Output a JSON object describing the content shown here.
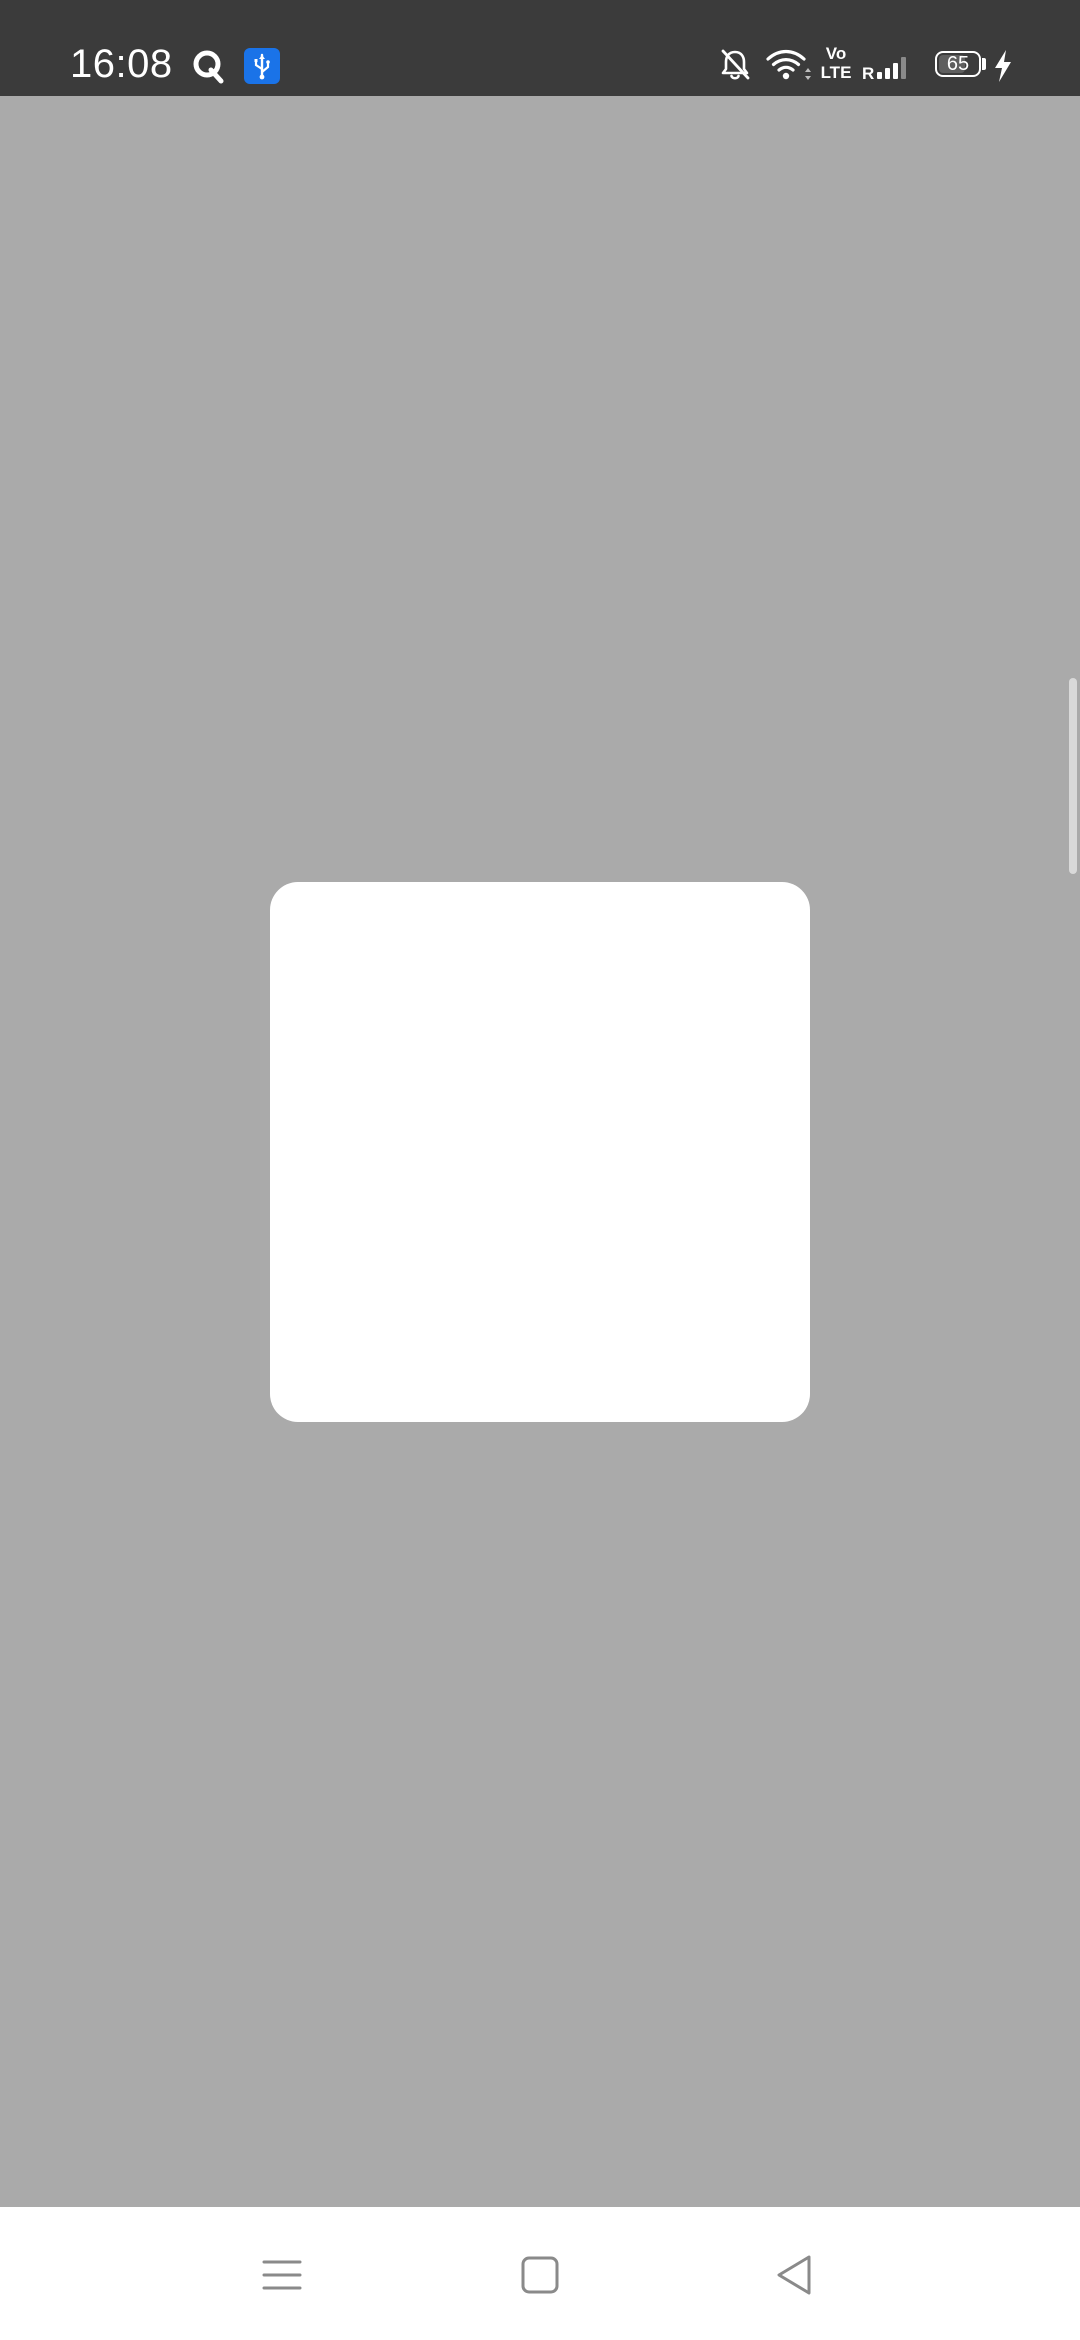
{
  "status_bar": {
    "time": "16:08",
    "volte_top": "Vo",
    "volte_bottom": "LTE",
    "roaming_indicator": "R",
    "battery_level": "65",
    "icons": [
      "q-app-icon",
      "usb-debug-icon",
      "bell-muted-icon",
      "wifi-icon",
      "cell-signal-icon",
      "charging-bolt-icon"
    ]
  },
  "nav_bar": {
    "icons": [
      "menu-icon",
      "home-icon",
      "back-icon"
    ]
  },
  "colors": {
    "status_bar_bg": "#3b3b3b",
    "overlay_bg": "#aaaaaa",
    "card_bg": "#ffffff",
    "usb_badge": "#1a73e8",
    "nav_icon": "#8a8a8a"
  }
}
